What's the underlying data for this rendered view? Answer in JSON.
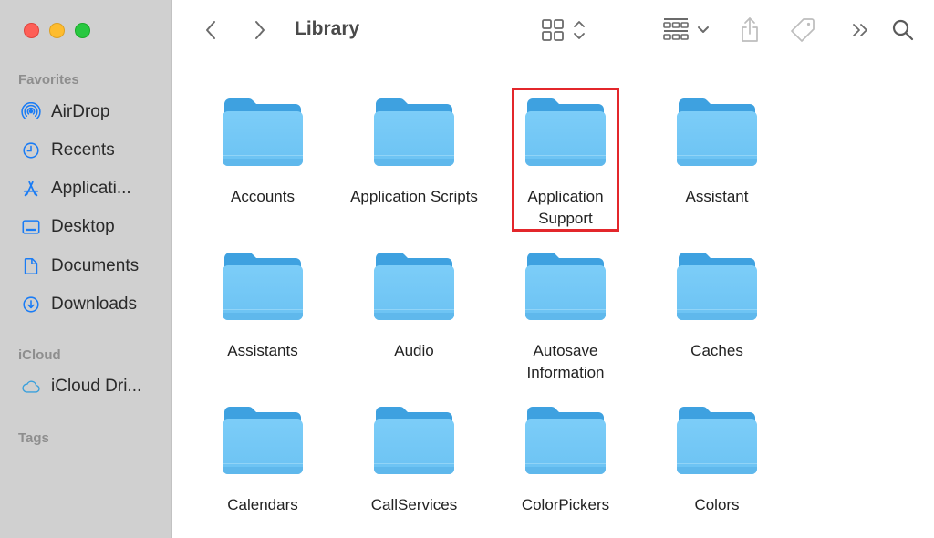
{
  "window": {
    "title": "Library",
    "controls": [
      "close",
      "minimize",
      "zoom"
    ]
  },
  "sidebar": {
    "sections": [
      {
        "title": "Favorites",
        "items": [
          {
            "label": "AirDrop",
            "icon": "airdrop-icon"
          },
          {
            "label": "Recents",
            "icon": "clock-icon"
          },
          {
            "label": "Applicati...",
            "icon": "applications-icon"
          },
          {
            "label": "Desktop",
            "icon": "desktop-icon"
          },
          {
            "label": "Documents",
            "icon": "document-icon"
          },
          {
            "label": "Downloads",
            "icon": "download-icon"
          }
        ]
      },
      {
        "title": "iCloud",
        "items": [
          {
            "label": "iCloud Dri...",
            "icon": "cloud-icon"
          }
        ]
      },
      {
        "title": "Tags",
        "items": []
      }
    ]
  },
  "toolbar": {
    "back_icon": "chevron-left-icon",
    "forward_icon": "chevron-right-icon",
    "view_icon": "icon-view-grid-icon",
    "group_icon": "group-by-icon",
    "share_icon": "share-icon",
    "tag_icon": "tag-icon",
    "more_icon": "double-chevron-right-icon",
    "search_icon": "search-icon"
  },
  "folders": [
    {
      "name": "Accounts",
      "selected": false
    },
    {
      "name": "Application Scripts",
      "selected": false
    },
    {
      "name": "Application Support",
      "selected": true
    },
    {
      "name": "Assistant",
      "selected": false
    },
    {
      "name": "Assistants",
      "selected": false
    },
    {
      "name": "Audio",
      "selected": false
    },
    {
      "name": "Autosave Information",
      "selected": false
    },
    {
      "name": "Caches",
      "selected": false
    },
    {
      "name": "Calendars",
      "selected": false
    },
    {
      "name": "CallServices",
      "selected": false
    },
    {
      "name": "ColorPickers",
      "selected": false
    },
    {
      "name": "Colors",
      "selected": false
    }
  ],
  "colors": {
    "accent": "#1a7cf5",
    "highlight": "#e3262b",
    "folder_front": "#74c9f6",
    "folder_back": "#3ea1e0"
  }
}
